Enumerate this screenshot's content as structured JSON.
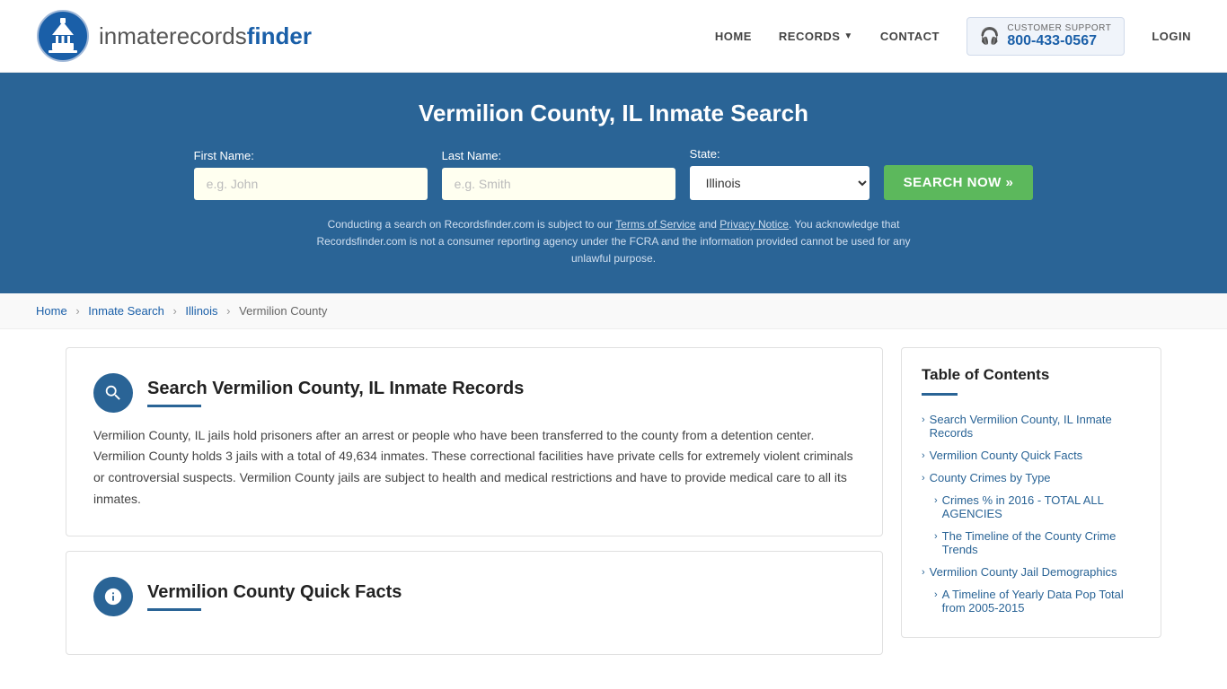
{
  "header": {
    "logo_text_light": "inmaterecords",
    "logo_text_bold": "finder",
    "nav": {
      "home": "HOME",
      "records": "RECORDS",
      "contact": "CONTACT",
      "support_label": "CUSTOMER SUPPORT",
      "support_number": "800-433-0567",
      "login": "LOGIN"
    }
  },
  "hero": {
    "title": "Vermilion County, IL Inmate Search",
    "first_name_label": "First Name:",
    "first_name_placeholder": "e.g. John",
    "last_name_label": "Last Name:",
    "last_name_placeholder": "e.g. Smith",
    "state_label": "State:",
    "state_value": "Illinois",
    "search_button": "SEARCH NOW »",
    "disclaimer": "Conducting a search on Recordsfinder.com is subject to our Terms of Service and Privacy Notice. You acknowledge that Recordsfinder.com is not a consumer reporting agency under the FCRA and the information provided cannot be used for any unlawful purpose.",
    "terms_link": "Terms of Service",
    "privacy_link": "Privacy Notice"
  },
  "breadcrumb": {
    "home": "Home",
    "inmate_search": "Inmate Search",
    "illinois": "Illinois",
    "county": "Vermilion County"
  },
  "main_section": {
    "title": "Search Vermilion County, IL Inmate Records",
    "body": "Vermilion County, IL jails hold prisoners after an arrest or people who have been transferred to the county from a detention center. Vermilion County holds 3 jails with a total of 49,634 inmates. These correctional facilities have private cells for extremely violent criminals or controversial suspects. Vermilion County jails are subject to health and medical restrictions and have to provide medical care to all its inmates."
  },
  "quick_facts_section": {
    "title": "Vermilion County Quick Facts"
  },
  "toc": {
    "title": "Table of Contents",
    "items": [
      {
        "label": "Search Vermilion County, IL Inmate Records",
        "indent": false
      },
      {
        "label": "Vermilion County Quick Facts",
        "indent": false
      },
      {
        "label": "County Crimes by Type",
        "indent": false
      },
      {
        "label": "Crimes % in 2016 - TOTAL ALL AGENCIES",
        "indent": true
      },
      {
        "label": "The Timeline of the County Crime Trends",
        "indent": true
      },
      {
        "label": "Vermilion County Jail Demographics",
        "indent": false
      },
      {
        "label": "A Timeline of Yearly Data Pop Total from 2005-2015",
        "indent": true
      }
    ]
  }
}
